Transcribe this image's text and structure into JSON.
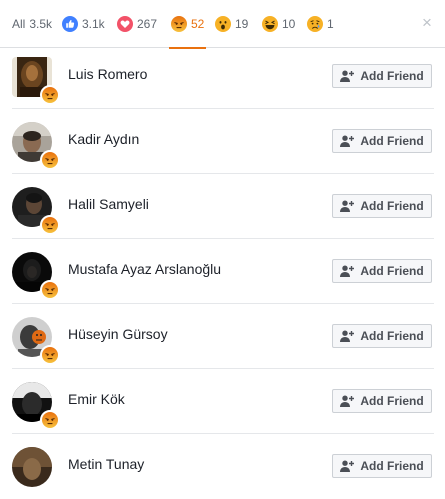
{
  "tabs": {
    "all": {
      "label": "All",
      "count": "3.5k"
    },
    "like": {
      "count": "3.1k",
      "icon": "like-icon",
      "color": "#4080ff"
    },
    "love": {
      "count": "267",
      "icon": "love-icon",
      "color": "#f25268"
    },
    "angry": {
      "count": "52",
      "icon": "angry-icon",
      "color": "#e9710f"
    },
    "wow": {
      "count": "19",
      "icon": "wow-icon",
      "color": "#f7b125"
    },
    "haha": {
      "count": "10",
      "icon": "haha-icon",
      "color": "#f7b125"
    },
    "sad": {
      "count": "1",
      "icon": "sad-icon",
      "color": "#f7b125"
    }
  },
  "close_icon": "×",
  "people": [
    {
      "name": "Luis Romero",
      "button": "Add Friend"
    },
    {
      "name": "Kadir Aydın",
      "button": "Add Friend"
    },
    {
      "name": "Halil Samyeli",
      "button": "Add Friend"
    },
    {
      "name": "Mustafa Ayaz Arslanoğlu",
      "button": "Add Friend"
    },
    {
      "name": "Hüseyin Gürsoy",
      "button": "Add Friend"
    },
    {
      "name": "Emir Kök",
      "button": "Add Friend"
    },
    {
      "name": "Metin Tunay",
      "button": "Add Friend"
    }
  ]
}
